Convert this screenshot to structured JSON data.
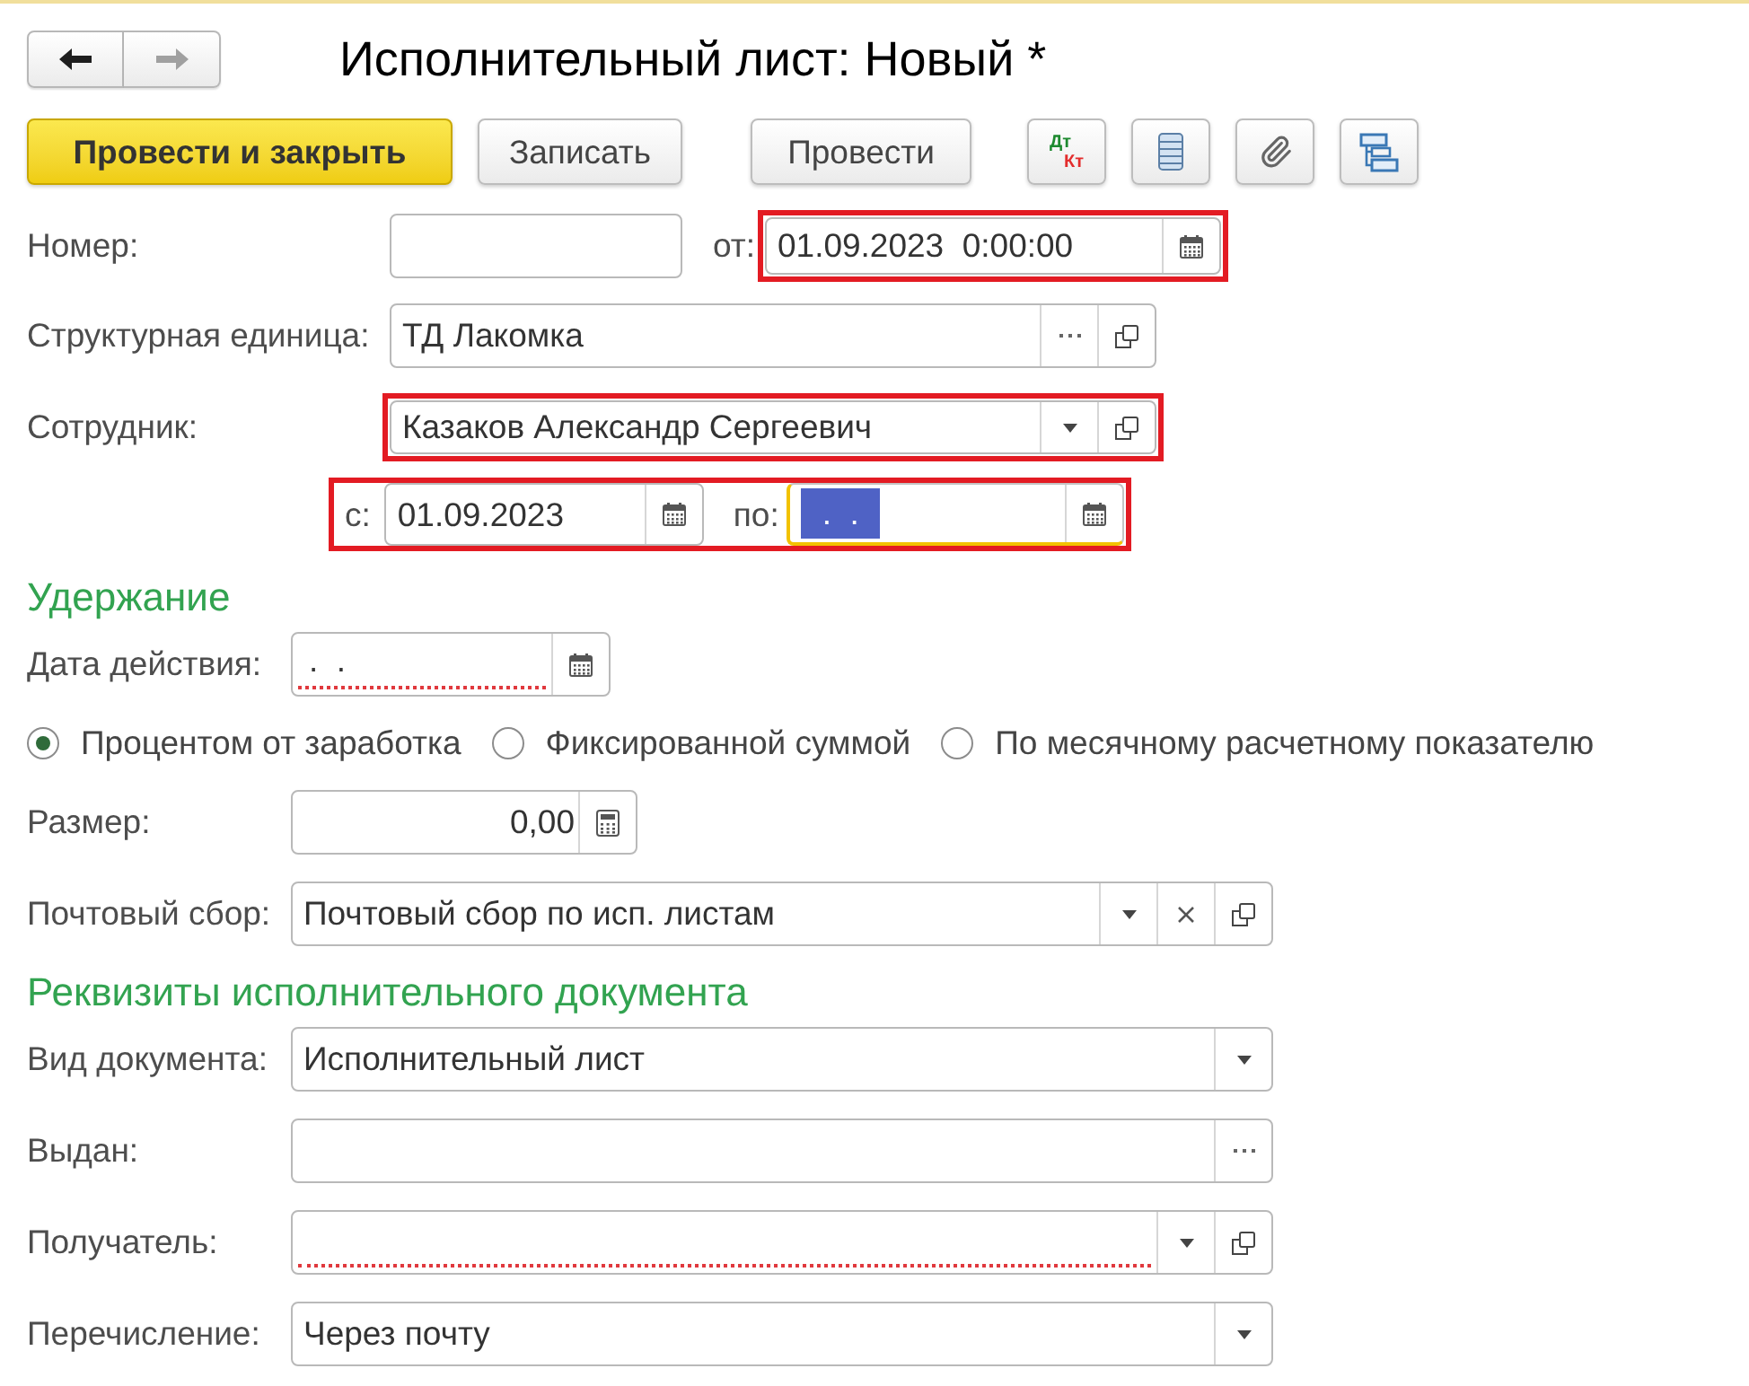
{
  "window": {
    "title": "Исполнительный лист: Новый *"
  },
  "nav_buttons": [
    {
      "kind": "back",
      "disabled": false
    },
    {
      "kind": "forward",
      "disabled": true
    }
  ],
  "toolbar": {
    "buttons": [
      {
        "label": "Провести и закрыть",
        "default": true
      },
      {
        "label": "Записать",
        "default": false
      },
      {
        "label": "Провести",
        "default": false
      }
    ],
    "icon_buttons": [
      {
        "kind": "debit-credit",
        "lines": [
          "Дт",
          "Кт"
        ]
      },
      {
        "kind": "list"
      },
      {
        "kind": "attachment"
      },
      {
        "kind": "structure"
      }
    ]
  },
  "header": {
    "number": {
      "label": "Номер:"
    },
    "date": {
      "label": "от:",
      "value": "01.09.2023  0:00:00",
      "highlighted": true,
      "buttons": [
        {
          "kind": "calendar"
        }
      ]
    }
  },
  "fields": [
    {
      "label": "Структурная единица:",
      "value": "ТД Лакомка",
      "highlighted": false,
      "buttons": [
        {
          "kind": "choose"
        },
        {
          "kind": "open"
        }
      ]
    },
    {
      "label": "Сотрудник:",
      "value": "Казаков Александр Сергеевич",
      "highlighted": true,
      "buttons": [
        {
          "kind": "dropdown"
        },
        {
          "kind": "open"
        }
      ]
    }
  ],
  "period": {
    "highlighted": true,
    "fields": [
      {
        "label": "с:",
        "value": "01.09.2023",
        "focused": false,
        "buttons": [
          {
            "kind": "calendar"
          }
        ]
      },
      {
        "label": "по:",
        "value": ".  .",
        "focused": true,
        "buttons": [
          {
            "kind": "calendar"
          }
        ]
      }
    ]
  },
  "sections": [
    {
      "title": "Удержание",
      "rows": [
        {
          "kind": "date",
          "label": "Дата действия:",
          "value": ".  .",
          "required": true,
          "buttons": [
            {
              "kind": "calendar"
            }
          ]
        },
        {
          "kind": "radio",
          "options": [
            {
              "label": "Процентом от заработка",
              "selected": true
            },
            {
              "label": "Фиксированной суммой",
              "selected": false
            },
            {
              "label": "По месячному расчетному показателю",
              "selected": false
            }
          ]
        },
        {
          "kind": "number",
          "label": "Размер:",
          "value": "0,00",
          "required": false,
          "buttons": [
            {
              "kind": "calculator"
            }
          ]
        },
        {
          "kind": "field",
          "label": "Почтовый сбор:",
          "value": "Почтовый сбор по исп. листам",
          "required": false,
          "buttons": [
            {
              "kind": "dropdown"
            },
            {
              "kind": "clear"
            },
            {
              "kind": "open"
            }
          ]
        }
      ]
    },
    {
      "title": "Реквизиты исполнительного документа",
      "rows": [
        {
          "kind": "field",
          "label": "Вид документа:",
          "value": "Исполнительный лист",
          "required": false,
          "buttons": [
            {
              "kind": "dropdown"
            }
          ]
        },
        {
          "kind": "field",
          "label": "Выдан:",
          "required": false,
          "buttons": [
            {
              "kind": "choose"
            }
          ]
        },
        {
          "kind": "field",
          "label": "Получатель:",
          "required": true,
          "buttons": [
            {
              "kind": "dropdown"
            },
            {
              "kind": "open"
            }
          ]
        },
        {
          "kind": "field",
          "label": "Перечисление:",
          "value": "Через почту",
          "required": false,
          "buttons": [
            {
              "kind": "dropdown"
            }
          ]
        }
      ]
    }
  ]
}
